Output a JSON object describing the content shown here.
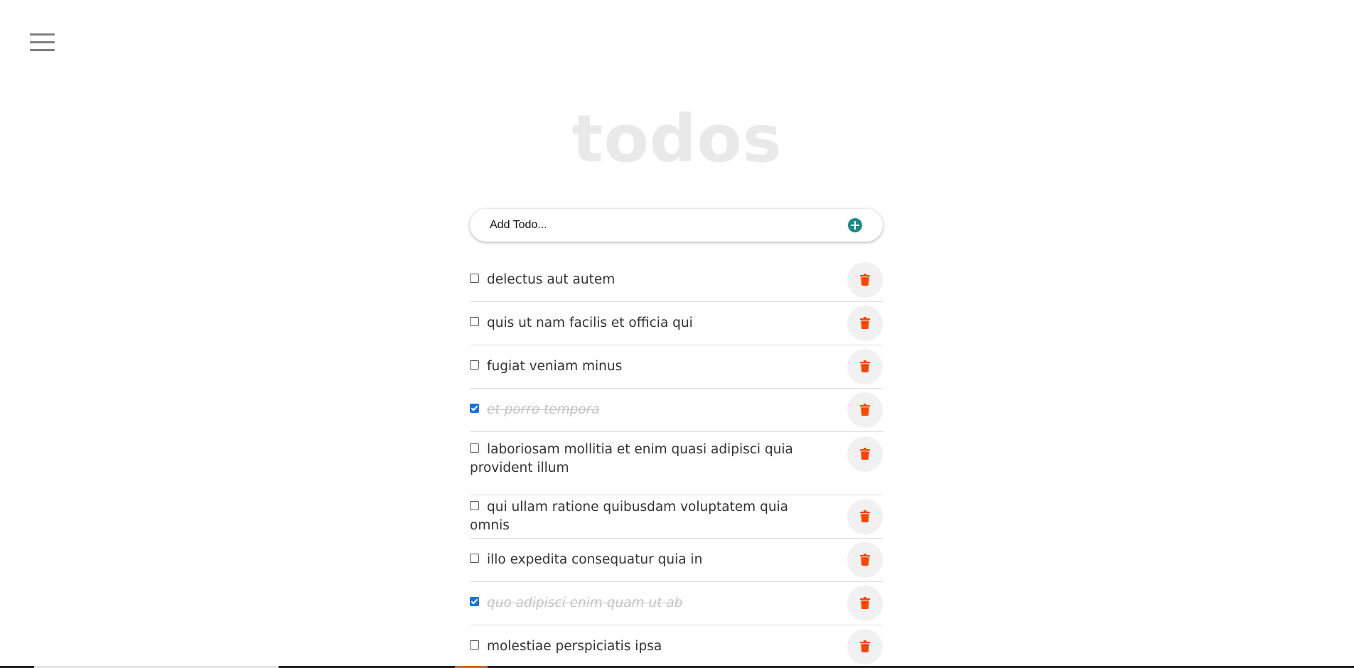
{
  "header": {
    "menu_icon": "hamburger-menu-icon",
    "title": "todos"
  },
  "add_form": {
    "placeholder": "Add Todo...",
    "add_icon": "plus-circle-icon",
    "accent_color": "#1a8a8a"
  },
  "todos": [
    {
      "text": "delectus aut autem",
      "completed": false
    },
    {
      "text": "quis ut nam facilis et officia qui",
      "completed": false
    },
    {
      "text": "fugiat veniam minus",
      "completed": false
    },
    {
      "text": "et porro tempora",
      "completed": true
    },
    {
      "text": "laboriosam mollitia et enim quasi adipisci quia provident illum",
      "completed": false
    },
    {
      "text": "qui ullam ratione quibusdam voluptatem quia omnis",
      "completed": false
    },
    {
      "text": "illo expedita consequatur quia in",
      "completed": false
    },
    {
      "text": "quo adipisci enim quam ut ab",
      "completed": true
    },
    {
      "text": "molestiae perspiciatis ipsa",
      "completed": false
    }
  ],
  "delete_icon": "trash-icon",
  "delete_color": "#ff4500"
}
